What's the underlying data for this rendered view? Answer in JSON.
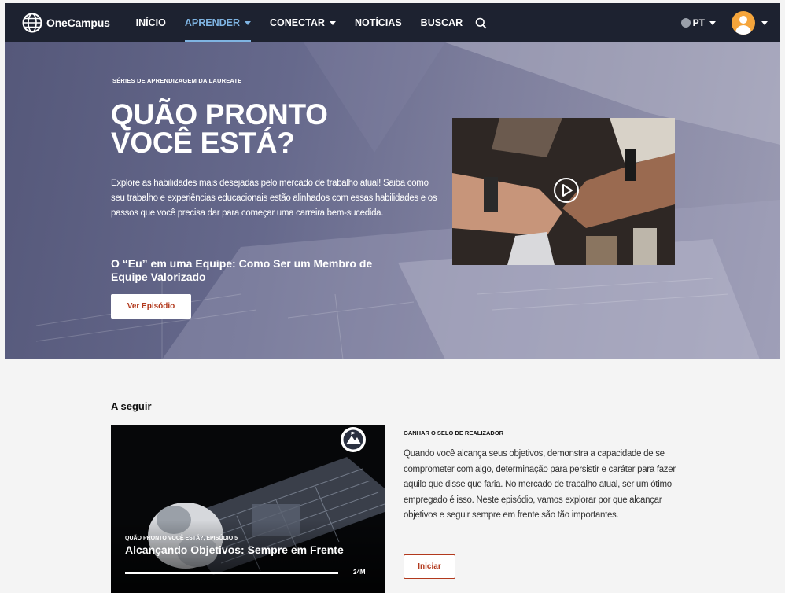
{
  "nav": {
    "logo_text": "OneCampus",
    "items": [
      {
        "label": "INÍCIO"
      },
      {
        "label": "APRENDER"
      },
      {
        "label": "CONECTAR"
      },
      {
        "label": "NOTÍCIAS"
      },
      {
        "label": "BUSCAR"
      }
    ],
    "lang": "PT",
    "accent_color": "#7fb4e2",
    "background_color": "#1d2230"
  },
  "hero": {
    "eyebrow": "SÉRIES DE APRENDIZAGEM DA LAUREATE",
    "title": "QUÃO PRONTO VOCÊ ESTÁ?",
    "description": "Explore as habilidades mais desejadas pelo mercado de trabalho atual! Saiba como seu trabalho e experiências educacionais estão alinhados com essas habilidades e os passos que você precisa dar para começar uma carreira bem-sucedida.",
    "episode_title": "O “Eu” em uma Equipe: Como Ser um Membro de Equipe Valorizado",
    "button_label": "Ver Episódio",
    "button_text_color": "#b2391d"
  },
  "next": {
    "section_title": "A seguir",
    "card": {
      "eyebrow": "QUÃO PRONTO VOCÊ ESTÁ?, EPISÓDIO 5",
      "title": "Alcançando Objetivos: Sempre em Frente",
      "duration": "24M",
      "progress": 1.0
    },
    "info": {
      "eyebrow": "GANHAR O SELO DE REALIZADOR",
      "description": "Quando você alcança seus objetivos, demonstra a capacidade de se comprometer com algo, determinação para persistir e caráter para fazer aquilo que disse que faria. No mercado de trabalho atual, ser um ótimo empregado é isso. Neste episódio, vamos explorar por que alcançar objetivos e seguir sempre em frente são tão importantes.",
      "button_label": "Iniciar"
    }
  }
}
